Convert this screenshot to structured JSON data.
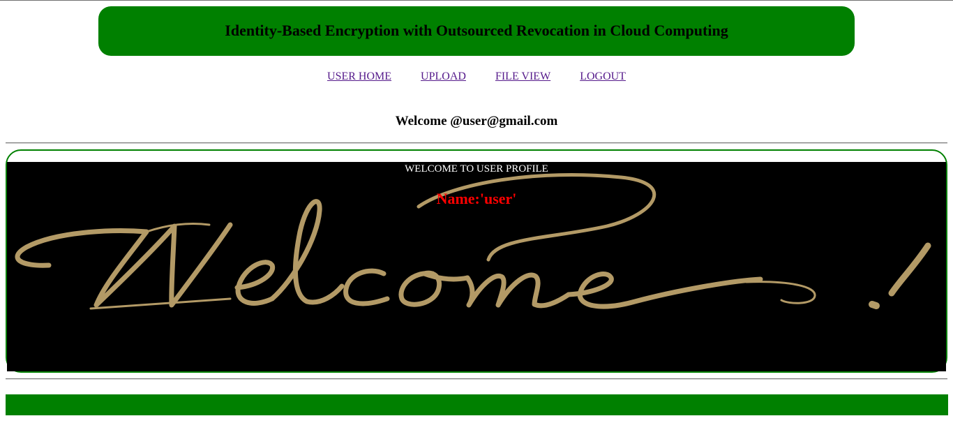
{
  "header": {
    "title": "Identity-Based Encryption with Outsourced Revocation in Cloud Computing"
  },
  "nav": {
    "items": [
      {
        "label": "USER HOME"
      },
      {
        "label": "UPLOAD"
      },
      {
        "label": "FILE VIEW"
      },
      {
        "label": "LOGOUT"
      }
    ]
  },
  "welcome": {
    "text": "Welcome @user@gmail.com"
  },
  "profile": {
    "heading": "WELCOME TO USER PROFILE",
    "name_text": "Name:'user'",
    "banner_script_text": "Welcome !"
  },
  "colors": {
    "brand_green": "#008000",
    "link_purple": "#551a8b",
    "name_red": "#ff0000",
    "banner_gold": "#b39a66",
    "banner_bg": "#000000"
  },
  "icons": {
    "banner_image": "welcome-script-image"
  }
}
